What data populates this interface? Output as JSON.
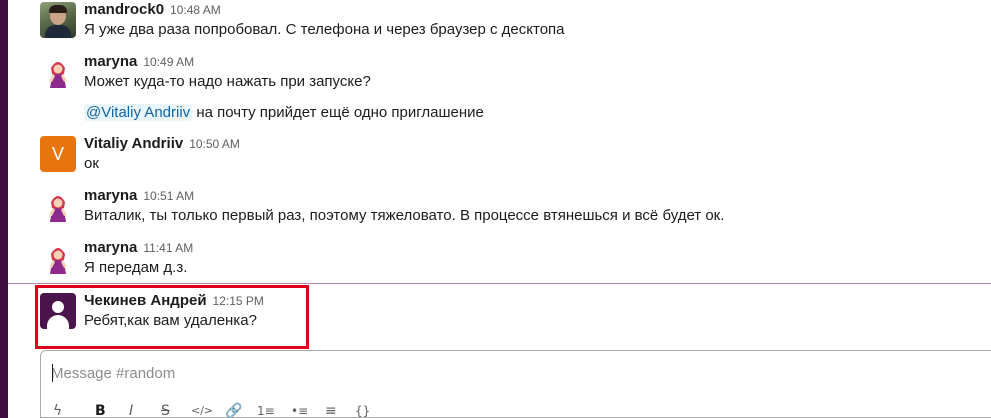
{
  "messages": [
    {
      "sender": "mandrock0",
      "time": "10:48 AM",
      "avatar": "photo-avatar",
      "lines": [
        "Я уже два раза попробовал. С телефона и через браузер с десктопа"
      ]
    },
    {
      "sender": "maryna",
      "time": "10:49 AM",
      "avatar": "masha-avatar",
      "lines": [
        "Может куда-то надо нажать при запуске?"
      ],
      "mention_line": {
        "mention": "@Vitaliy Andriiv",
        "text": " на почту прийдет ещё одно приглашение"
      }
    },
    {
      "sender": "Vitaliy Andriiv",
      "time": "10:50 AM",
      "avatar": "letter-avatar",
      "avatar_letter": "V",
      "lines": [
        "ок"
      ]
    },
    {
      "sender": "maryna",
      "time": "10:51 AM",
      "avatar": "masha-avatar",
      "lines": [
        "Виталик, ты только первый раз, поэтому тяжеловато. В процессе втянешься и всё будет ок."
      ]
    },
    {
      "sender": "maryna",
      "time": "11:41 AM",
      "avatar": "masha-avatar",
      "lines": [
        "Я передам д.з."
      ]
    },
    {
      "sender": "Чекинев Андрей",
      "time": "12:15 PM",
      "avatar": "default-avatar",
      "lines": [
        "Ребят,как вам удаленка?"
      ]
    }
  ],
  "composer": {
    "placeholder": "Message #random",
    "toolbar": {
      "shortcuts": "ϟ",
      "bold": "B",
      "italic": "I",
      "strike": "S",
      "code": "</>",
      "link": "🔗",
      "ordered_list": "1≡",
      "bulleted_list": "•≡",
      "blockquote": "≡",
      "code_block": "{}"
    }
  },
  "colors": {
    "sidebar": "#3f0e40",
    "new_divider": "#b77fae",
    "highlight_box": "#e0001b",
    "letter_avatar": "#e8750c",
    "mention_bg": "#e8f5fa",
    "mention_text": "#1264a3"
  }
}
